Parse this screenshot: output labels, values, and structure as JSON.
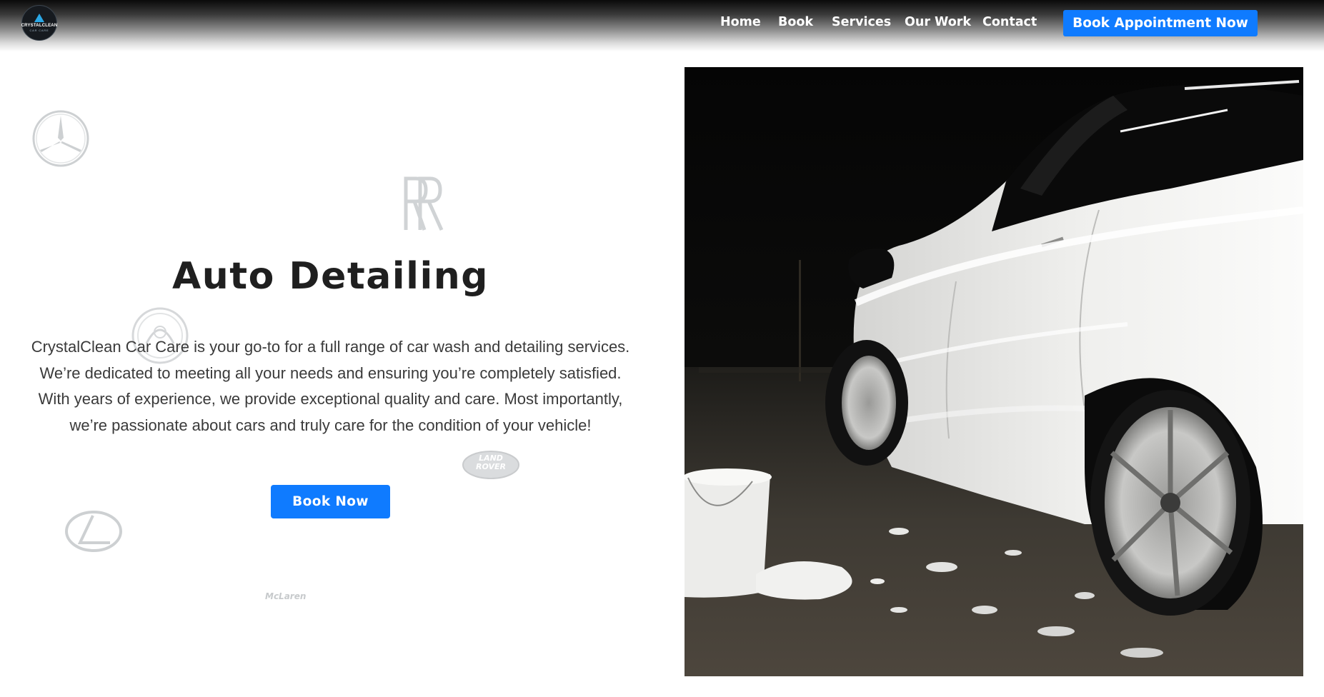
{
  "header": {
    "logo": {
      "name": "CRYSTALCLEAN",
      "tagline": "CAR CARE",
      "icon": "water-drop-icon"
    },
    "nav": [
      {
        "label": "Home"
      },
      {
        "label": "Book"
      },
      {
        "label": "Services"
      },
      {
        "label": "Our Work"
      },
      {
        "label": "Contact"
      }
    ],
    "cta_label": "Book Appointment Now"
  },
  "brand_watermarks": {
    "mercedes": "mercedes-benz-logo",
    "rolls_royce": "rolls-royce-logo",
    "lotus": "lotus-logo",
    "land_rover": {
      "line1": "LAND",
      "line2": "ROVER"
    },
    "lexus": "lexus-logo",
    "mclaren": "McLaren"
  },
  "hero": {
    "title": "Auto Detailing",
    "description": "CrystalClean Car Care is your go-to for a full range of car wash and detailing services. We’re dedicated to meeting all your needs and ensuring you’re completely satisfied. With years of experience, we provide exceptional quality and care. Most importantly, we’re passionate about cars and truly care for the condition of your vehicle!",
    "cta_label": "Book Now",
    "image": "white-car-covered-in-foam-photo"
  },
  "colors": {
    "accent": "#0f7bff",
    "title_text": "#1f1f1f",
    "body_text": "#3a3a3a",
    "watermark": "#cfd2d4"
  }
}
